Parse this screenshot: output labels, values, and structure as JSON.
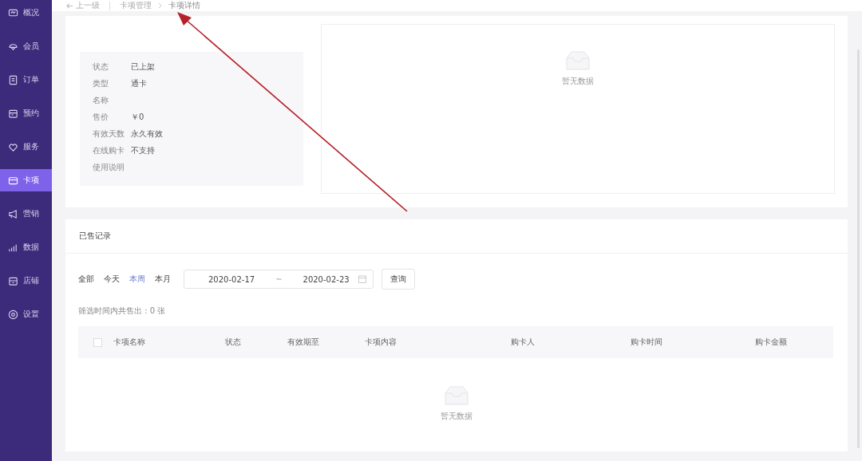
{
  "sidebar": {
    "items": [
      {
        "label": "概况",
        "selected": false
      },
      {
        "label": "会员",
        "selected": false
      },
      {
        "label": "订单",
        "selected": false
      },
      {
        "label": "预约",
        "selected": false
      },
      {
        "label": "服务",
        "selected": false
      },
      {
        "label": "卡项",
        "selected": true
      },
      {
        "label": "营销",
        "selected": false
      },
      {
        "label": "数据",
        "selected": false
      },
      {
        "label": "店铺",
        "selected": false
      },
      {
        "label": "设置",
        "selected": false
      }
    ]
  },
  "breadcrumb": {
    "back": "上一级",
    "items": [
      "卡项管理",
      "卡项详情"
    ]
  },
  "card_info": {
    "fields": [
      {
        "label": "状态",
        "value": "已上架"
      },
      {
        "label": "类型",
        "value": "通卡"
      },
      {
        "label": "名称"
      },
      {
        "label": "售价",
        "value": "￥0"
      },
      {
        "label": "有效天数",
        "value": "永久有效"
      },
      {
        "label": "在线购卡",
        "value": "不支持"
      },
      {
        "label": "使用说明"
      }
    ],
    "empty_text": "暂无数据"
  },
  "sales": {
    "title": "已售记录",
    "filters": [
      {
        "label": "全部",
        "selected": false
      },
      {
        "label": "今天",
        "selected": false
      },
      {
        "label": "本周",
        "selected": true
      },
      {
        "label": "本月",
        "selected": false
      }
    ],
    "date_range": {
      "start": "2020-02-17",
      "separator": "~",
      "end": "2020-02-23"
    },
    "query_button": "查询",
    "summary": "筛选时间内共售出 : 0 张",
    "table": {
      "select_all_checked": false,
      "columns": [
        "卡项名称",
        "状态",
        "有效期至",
        "卡项内容",
        "购卡人",
        "购卡时间",
        "购卡金额"
      ]
    },
    "empty_text": "暂无数据"
  }
}
